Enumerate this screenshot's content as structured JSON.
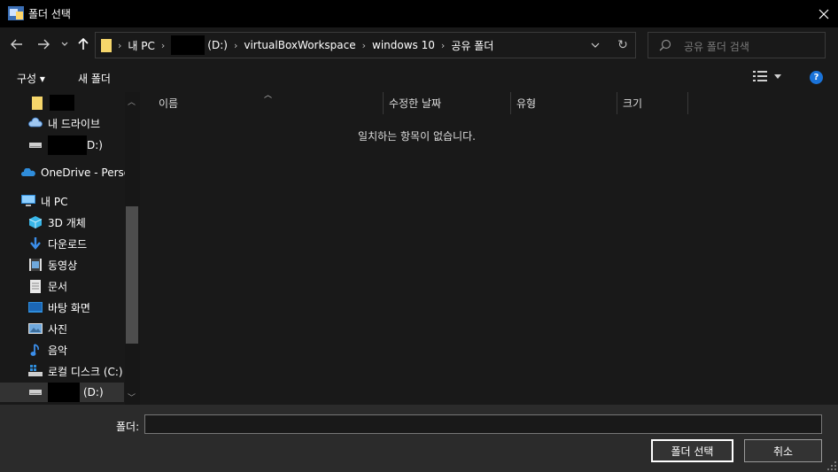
{
  "window": {
    "title": "폴더 선택"
  },
  "nav": {
    "breadcrumbs": [
      "내 PC",
      "(D:)",
      "virtualBoxWorkspace",
      "windows 10",
      "공유 폴더"
    ]
  },
  "search": {
    "placeholder": "공유 폴더 검색"
  },
  "toolbar": {
    "organize_label": "구성 ▾",
    "new_folder_label": "새 폴더"
  },
  "sidebar": {
    "items": [
      {
        "label": "",
        "icon": "folder-icon"
      },
      {
        "label": "내 드라이브",
        "icon": "cloud-drive-icon"
      },
      {
        "label": "D:)",
        "icon": "drive-icon"
      },
      {
        "label": "OneDrive - Persor",
        "icon": "onedrive-icon"
      },
      {
        "label": "내 PC",
        "icon": "computer-icon"
      },
      {
        "label": "3D 개체",
        "icon": "3d-objects-icon"
      },
      {
        "label": "다운로드",
        "icon": "download-icon"
      },
      {
        "label": "동영상",
        "icon": "video-icon"
      },
      {
        "label": "문서",
        "icon": "document-icon"
      },
      {
        "label": "바탕 화면",
        "icon": "desktop-icon"
      },
      {
        "label": "사진",
        "icon": "pictures-icon"
      },
      {
        "label": "음악",
        "icon": "music-icon"
      },
      {
        "label": "로컬 디스크 (C:)",
        "icon": "local-disk-icon"
      },
      {
        "label": "(D:)",
        "icon": "drive-icon"
      }
    ]
  },
  "content": {
    "columns": [
      "이름",
      "수정한 날짜",
      "유형",
      "크기"
    ],
    "empty_message": "일치하는 항목이 없습니다."
  },
  "footer": {
    "folder_label": "폴더:",
    "folder_value": "",
    "select_button": "폴더 선택",
    "cancel_button": "취소"
  },
  "colors": {
    "accent": "#1a73d9",
    "background": "#191919",
    "titlebar": "#000000"
  }
}
